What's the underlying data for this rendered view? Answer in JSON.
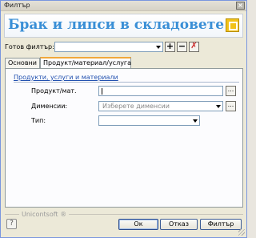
{
  "window": {
    "title": "Филтър",
    "close_label": "×"
  },
  "header": {
    "title": "Брак и липси в складовете"
  },
  "filter": {
    "label": "Готов филтър:",
    "value": "",
    "add_label": "+",
    "remove_label": "−",
    "clear_label": "✗"
  },
  "tabs": [
    {
      "label": "Основни",
      "active": false
    },
    {
      "label": "Продукт/материал/услуга",
      "active": true
    }
  ],
  "section": {
    "title": "Продукти, услуги и материали"
  },
  "fields": {
    "product": {
      "label": "Продукт/мат.",
      "value": "",
      "browse_label": "..."
    },
    "dimensions": {
      "label": "Дименсии:",
      "placeholder": "Изберете дименсии",
      "browse_label": "..."
    },
    "type": {
      "label": "Тип:",
      "value": ""
    }
  },
  "footer": {
    "brand": "Unicontsoft ®",
    "help_label": "?",
    "ok_label": "Ок",
    "cancel_label": "Отказ",
    "filter_label": "Филтър"
  }
}
